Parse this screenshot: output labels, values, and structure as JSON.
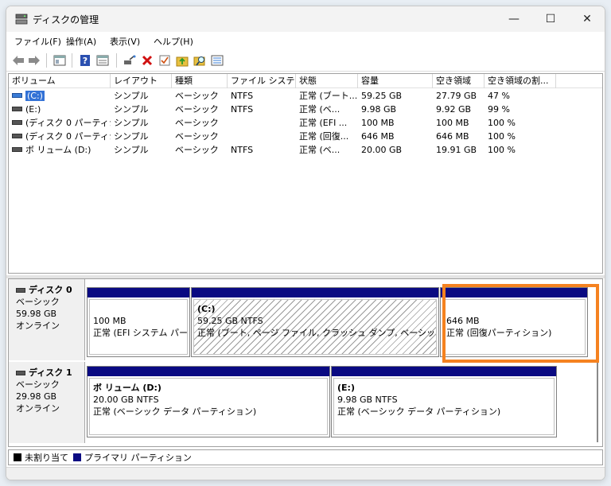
{
  "window": {
    "title": "ディスクの管理",
    "minimize": "—",
    "maximize": "☐",
    "close": "✕"
  },
  "menu": [
    "ファイル(F)",
    "操作(A)",
    "表示(V)",
    "ヘルプ(H)"
  ],
  "toolbar": {
    "icons": [
      "back-arrow-icon",
      "forward-arrow-icon",
      "console-tree-icon",
      "help-icon",
      "properties-icon",
      "connect-icon",
      "delete-icon",
      "check-icon",
      "folder-up-icon",
      "search-folder-icon",
      "list-icon"
    ],
    "colors": {
      "delete": "#d01010",
      "help": "#2a4fb0",
      "folder": "#e8c040"
    }
  },
  "volume_table": {
    "columns": [
      "ボリューム",
      "レイアウト",
      "種類",
      "ファイル システム",
      "状態",
      "容量",
      "空き領域",
      "空き領域の割..."
    ],
    "rows": [
      [
        "(C:)",
        "シンプル",
        "ベーシック",
        "NTFS",
        "正常 (ブート...",
        "59.25 GB",
        "27.79 GB",
        "47 %"
      ],
      [
        "(E:)",
        "シンプル",
        "ベーシック",
        "NTFS",
        "正常 (ベ...",
        "9.98 GB",
        "9.92 GB",
        "99 %"
      ],
      [
        "(ディスク 0 パーティシ...",
        "シンプル",
        "ベーシック",
        "",
        "正常 (EFI ...",
        "100 MB",
        "100 MB",
        "100 %"
      ],
      [
        "(ディスク 0 パーティシ...",
        "シンプル",
        "ベーシック",
        "",
        "正常 (回復...",
        "646 MB",
        "646 MB",
        "100 %"
      ],
      [
        "ボ リューム (D:)",
        "シンプル",
        "ベーシック",
        "NTFS",
        "正常 (ベ...",
        "20.00 GB",
        "19.91 GB",
        "100 %"
      ]
    ],
    "selected_row": 0
  },
  "disks": [
    {
      "name": "ディスク 0",
      "type": "ベーシック",
      "size": "59.98 GB",
      "status": "オンライン",
      "partitions": [
        {
          "title": "",
          "size": "100 MB",
          "status": "正常 (EFI システム パーテ"
        },
        {
          "title": "(C:)",
          "size": "59.25 GB NTFS",
          "status": "正常 (ブート, ページ ファイル, クラッシュ ダンプ, ベーシック データ パ"
        },
        {
          "title": "",
          "size": "646 MB",
          "status": "正常 (回復パーティション)"
        }
      ]
    },
    {
      "name": "ディスク 1",
      "type": "ベーシック",
      "size": "29.98 GB",
      "status": "オンライン",
      "partitions": [
        {
          "title": "ボ リューム  (D:)",
          "size": "20.00 GB NTFS",
          "status": "正常 (ベーシック データ パーティション)"
        },
        {
          "title": "(E:)",
          "size": "9.98 GB NTFS",
          "status": "正常 (ベーシック データ パーティション)"
        }
      ]
    }
  ],
  "legend": [
    {
      "label": "未割り当て",
      "color": "#000000"
    },
    {
      "label": "プライマリ パーティション",
      "color": "#0a0a82"
    }
  ],
  "colors": {
    "selection": "#3372d6",
    "partition_bar": "#0a0a82",
    "highlight": "#f58220"
  }
}
